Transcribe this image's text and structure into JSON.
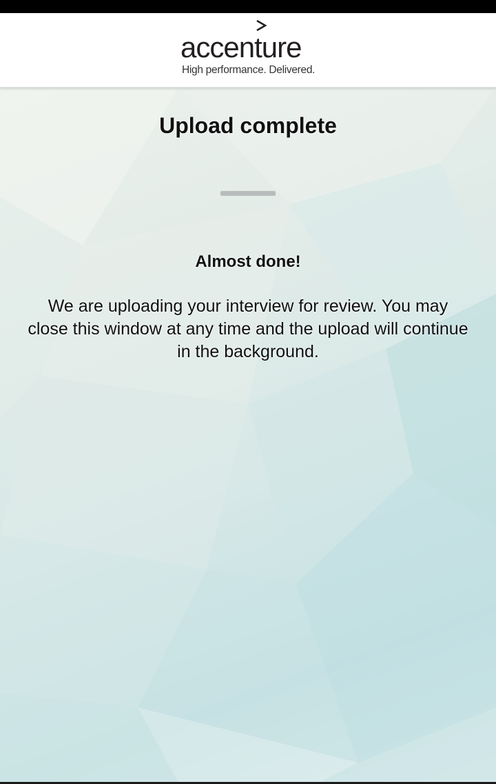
{
  "header": {
    "logo_text": "accenture",
    "tagline": "High performance. Delivered."
  },
  "main": {
    "title": "Upload complete",
    "subtitle": "Almost done!",
    "message": "We are uploading your interview for review. You may close this window at any time and the upload will continue in the background."
  },
  "colors": {
    "header_bg": "#ffffff",
    "text": "#111111",
    "divider": "#b8bcbd",
    "background_tint": "#c4e1e3"
  },
  "icons": {
    "brand_mark": "chevron-right-icon"
  }
}
